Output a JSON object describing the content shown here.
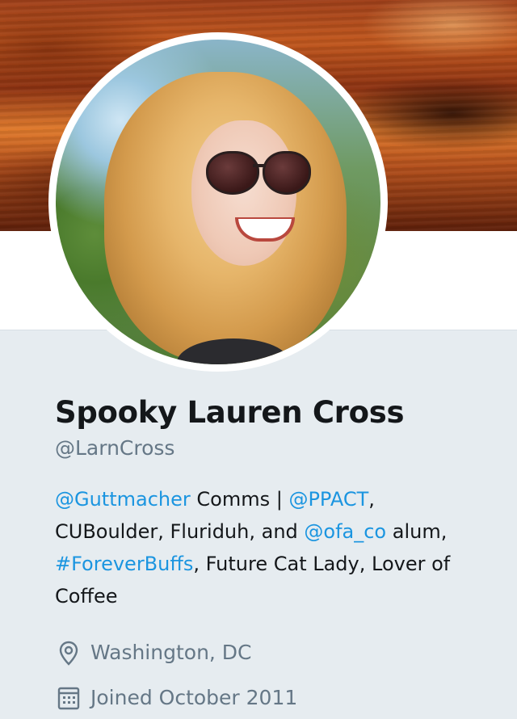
{
  "profile": {
    "name": "Spooky Lauren Cross",
    "handle": "@LarnCross"
  },
  "bio": {
    "parts": [
      {
        "text": "@Guttmacher",
        "type": "mention"
      },
      {
        "text": " Comms | ",
        "type": "text"
      },
      {
        "text": "@PPACT",
        "type": "mention"
      },
      {
        "text": ", CUBoulder, Fluriduh, and ",
        "type": "text"
      },
      {
        "text": "@ofa_co",
        "type": "mention"
      },
      {
        "text": " alum, ",
        "type": "text"
      },
      {
        "text": "#ForeverBuffs",
        "type": "hashtag"
      },
      {
        "text": ", Future Cat Lady, Lover of Coffee",
        "type": "text"
      }
    ]
  },
  "meta": {
    "location": "Washington, DC",
    "location_icon": "location-pin-icon",
    "joined": "Joined October 2011",
    "joined_icon": "calendar-icon"
  },
  "colors": {
    "link": "#1b95e0",
    "secondary_text": "#657786",
    "background": "#e6ecf0"
  }
}
